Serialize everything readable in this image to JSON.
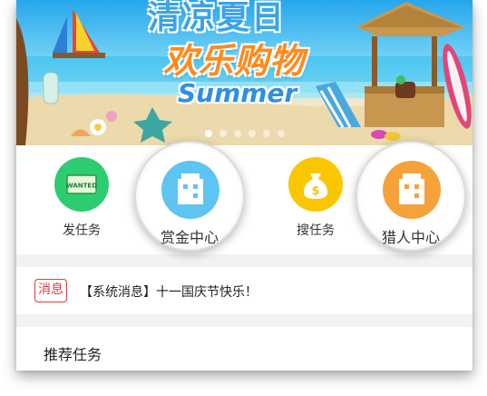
{
  "banner": {
    "title_top": "清凉夏日",
    "title_main": "欢乐购物",
    "title_en": "Summer",
    "slide_count": 6,
    "active_slide": 0
  },
  "grid": {
    "items": [
      {
        "label": "发任务",
        "icon": "wanted-icon",
        "icon_text": "WANTED",
        "color": "#2ecc71"
      },
      {
        "label": "赏金中心",
        "icon": "building-icon",
        "color": "#5ec4f2",
        "magnified": true
      },
      {
        "label": "搜任务",
        "icon": "money-bag-icon",
        "color": "#f9c600"
      },
      {
        "label": "猎人中心",
        "icon": "building-icon",
        "color": "#f6a23a",
        "magnified": true
      }
    ]
  },
  "message": {
    "tag": "消息",
    "text": "【系统消息】十一国庆节快乐！",
    "tag_color": "#e23b3b"
  },
  "recommend": {
    "title": "推荐任务"
  }
}
